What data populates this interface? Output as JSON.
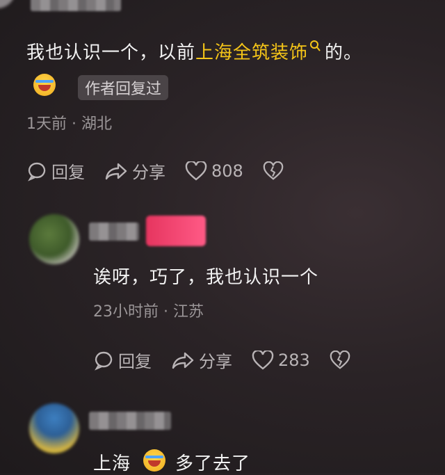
{
  "comment1": {
    "text_before": "我也认识一个，以前",
    "link_text": "上海全筑装饰",
    "text_after": "的。",
    "author_tag": "作者回复过",
    "meta": "1天前 · 湖北",
    "reply": "回复",
    "share": "分享",
    "likes": "808"
  },
  "comment2": {
    "text": "诶呀，巧了，我也认识一个",
    "meta": "23小时前 · 江苏",
    "reply": "回复",
    "share": "分享",
    "likes": "283"
  },
  "comment3": {
    "text_before": "上海",
    "text_after": "多了去了"
  },
  "colors": {
    "link": "#f5c518",
    "accent_pink": "#ff3b6b"
  }
}
